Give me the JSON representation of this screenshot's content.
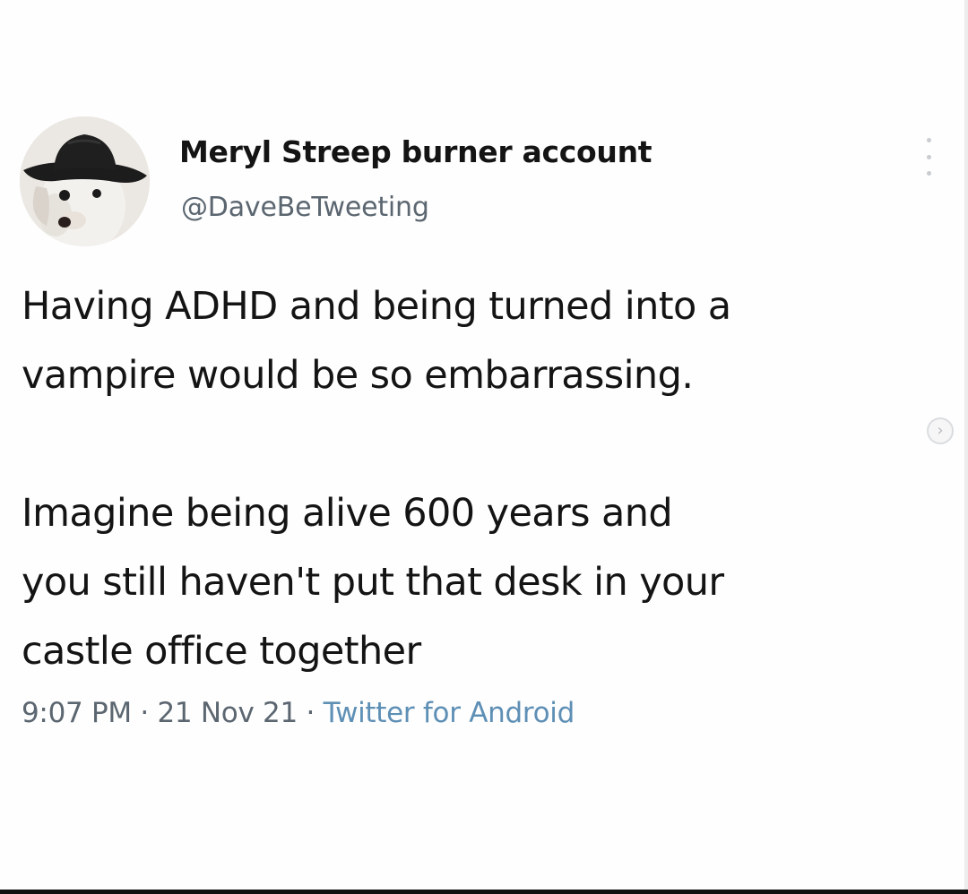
{
  "tweet": {
    "author": {
      "display_name": "Meryl Streep burner account",
      "handle": "@DaveBeTweeting",
      "avatar_icon": "dog-with-cowboy-hat-avatar"
    },
    "body": {
      "paragraph_1": "Having ADHD and being turned into a\nvampire would be so embarrassing.",
      "paragraph_2": "Imagine being alive 600 years and\nyou still haven't put that desk in your\ncastle office together"
    },
    "meta": {
      "time": "9:07 PM",
      "separator": " · ",
      "date": "21 Nov 21",
      "source": "Twitter for Android"
    },
    "more_icon": "vertical-ellipsis-icon",
    "nav_arrow_icon": "chevron-right-icon",
    "nav_arrow_glyph": "›"
  },
  "colors": {
    "background": "#fefefe",
    "text": "#141414",
    "secondary_text": "#5b6670",
    "source_link": "#5e8fb5"
  }
}
